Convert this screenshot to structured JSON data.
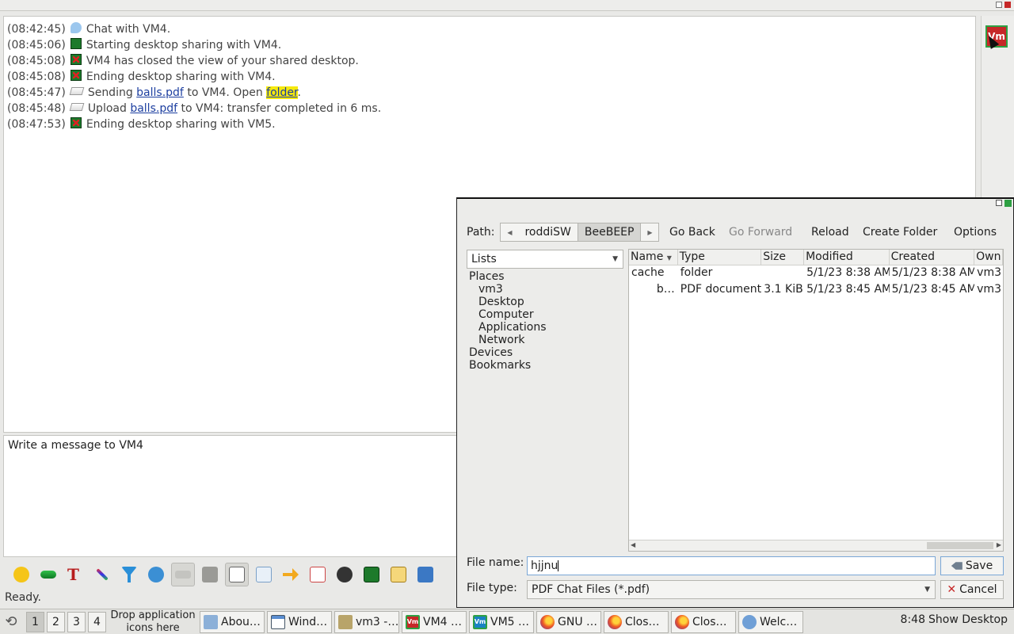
{
  "chat": {
    "lines": [
      {
        "ts": "(08:42:45)",
        "icon": "chat-bubble-icon",
        "text": "Chat with VM4."
      },
      {
        "ts": "(08:45:06)",
        "icon": "desktop-share-icon",
        "text": "Starting desktop sharing with VM4."
      },
      {
        "ts": "(08:45:08)",
        "icon": "desktop-share-stop-icon",
        "text": "VM4 has closed the view of your shared desktop."
      },
      {
        "ts": "(08:45:08)",
        "icon": "desktop-share-stop-icon",
        "text": "Ending desktop sharing with VM4."
      },
      {
        "ts": "(08:45:47)",
        "icon": "file-transfer-icon",
        "pre": "Sending ",
        "link": "balls.pdf",
        "mid": " to VM4. Open ",
        "link2": "folder",
        "post": "."
      },
      {
        "ts": "(08:45:48)",
        "icon": "file-transfer-icon",
        "pre": "Upload ",
        "link": "balls.pdf",
        "mid": " to VM4: transfer completed in 6 ms."
      },
      {
        "ts": "(08:47:53)",
        "icon": "desktop-share-stop-icon",
        "text": "Ending desktop sharing with VM5."
      }
    ]
  },
  "side": {
    "avatar": "Vm"
  },
  "compose": {
    "placeholder": "Write a message to VM4"
  },
  "status": {
    "text": "Ready."
  },
  "dialog": {
    "path_label": "Path:",
    "crumbs": [
      "roddiSW",
      "BeeBEEP"
    ],
    "go_back": "Go Back",
    "go_forward": "Go Forward",
    "reload": "Reload",
    "create_folder": "Create Folder",
    "options": "Options",
    "places_dropdown": "Lists",
    "places": {
      "header": "Places",
      "items": [
        "vm3",
        "Desktop",
        "Computer",
        "Applications",
        "Network"
      ],
      "devices": "Devices",
      "bookmarks": "Bookmarks"
    },
    "columns": [
      "Name",
      "Type",
      "Size",
      "Modified",
      "Created",
      "Own"
    ],
    "rows": [
      {
        "name": "cache",
        "type": "folder",
        "size": "",
        "modified": "5/1/23 8:38 AM",
        "created": "5/1/23 8:38 AM",
        "owner": "vm3"
      },
      {
        "name": "b…",
        "type": "PDF document",
        "size": "3.1 KiB",
        "modified": "5/1/23 8:45 AM",
        "created": "5/1/23 8:45 AM",
        "owner": "vm3"
      }
    ],
    "file_name_label": "File name:",
    "file_name_value": "hjjnu",
    "file_type_label": "File type:",
    "file_type_value": "PDF Chat Files (*.pdf)",
    "save": "Save",
    "cancel": "Cancel"
  },
  "taskbar": {
    "workspaces": [
      "1",
      "2",
      "3",
      "4"
    ],
    "drop_text": "Drop application icons here",
    "tasks": [
      {
        "label": "Abou…",
        "icon": "about-icon"
      },
      {
        "label": "Wind…",
        "icon": "window-icon"
      },
      {
        "label": "vm3 -…",
        "icon": "file-manager-icon"
      },
      {
        "label": "VM4 …",
        "icon": "vm4-icon"
      },
      {
        "label": "VM5 …",
        "icon": "vm5-icon"
      },
      {
        "label": "GNU …",
        "icon": "firefox-icon"
      },
      {
        "label": "Clos…",
        "icon": "firefox-icon"
      },
      {
        "label": "Clos…",
        "icon": "firefox-icon"
      },
      {
        "label": "Welc…",
        "icon": "welcome-icon"
      }
    ],
    "clock": "8:48",
    "show_desktop": "Show Desktop"
  }
}
